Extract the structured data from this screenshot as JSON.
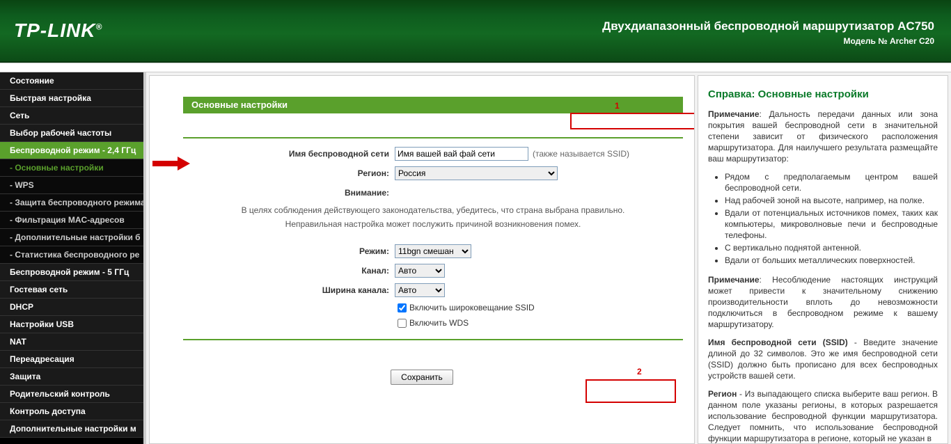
{
  "header": {
    "brand": "TP-LINK",
    "title": "Двухдиапазонный беспроводной маршрутизатор AC750",
    "model": "Модель № Archer C20"
  },
  "sidebar": {
    "items": [
      {
        "label": "Состояние",
        "type": "item"
      },
      {
        "label": "Быстрая настройка",
        "type": "item"
      },
      {
        "label": "Сеть",
        "type": "item"
      },
      {
        "label": "Выбор рабочей частоты",
        "type": "item"
      },
      {
        "label": "Беспроводной режим - 2,4 ГГц",
        "type": "active"
      },
      {
        "label": "- Основные настройки",
        "type": "sub-selected"
      },
      {
        "label": "- WPS",
        "type": "sub"
      },
      {
        "label": "- Защита беспроводного режима",
        "type": "sub"
      },
      {
        "label": "- Фильтрация MAC-адресов",
        "type": "sub"
      },
      {
        "label": "- Дополнительные настройки б",
        "type": "sub"
      },
      {
        "label": "- Статистика беспроводного ре",
        "type": "sub"
      },
      {
        "label": "Беспроводной режим - 5 ГГц",
        "type": "item"
      },
      {
        "label": "Гостевая сеть",
        "type": "item"
      },
      {
        "label": "DHCP",
        "type": "item"
      },
      {
        "label": "Настройки USB",
        "type": "item"
      },
      {
        "label": "NAT",
        "type": "item"
      },
      {
        "label": "Переадресация",
        "type": "item"
      },
      {
        "label": "Защита",
        "type": "item"
      },
      {
        "label": "Родительский контроль",
        "type": "item"
      },
      {
        "label": "Контроль доступа",
        "type": "item"
      },
      {
        "label": "Дополнительные настройки м",
        "type": "item"
      }
    ]
  },
  "page": {
    "title": "Основные настройки",
    "step1": "1",
    "step2": "2",
    "labels": {
      "ssid": "Имя беспроводной сети",
      "region": "Регион:",
      "attention": "Внимание:",
      "mode": "Режим:",
      "channel": "Канал:",
      "width": "Ширина канала:"
    },
    "values": {
      "ssid": "Имя вашей вай фай сети",
      "region": "Россия",
      "mode": "11bgn смешан",
      "channel": "Авто",
      "width": "Авто"
    },
    "hints": {
      "ssid_note": "(также называется SSID)",
      "note1": "В целях соблюдения действующего законодательства, убедитесь, что страна выбрана правильно.",
      "note2": "Неправильная настройка может послужить причиной возникновения помех.",
      "cb1": "Включить широковещание SSID",
      "cb2": "Включить WDS"
    },
    "save": "Сохранить"
  },
  "help": {
    "title": "Справка: Основные настройки",
    "p1_bold": "Примечание",
    "p1": ": Дальность передачи данных или зона покрытия вашей беспроводной сети в значительной степени зависит от физического расположения маршрутизатора. Для наилучшего результата размещайте ваш маршрутизатор:",
    "bullets": [
      "Рядом с предполагаемым центром вашей беспроводной сети.",
      "Над рабочей зоной на высоте, например, на полке.",
      "Вдали от потенциальных источников помех, таких как компьютеры, микроволновые печи и беспроводные телефоны.",
      "С вертикально поднятой антенной.",
      "Вдали от больших металлических поверхностей."
    ],
    "p2_bold": "Примечание",
    "p2": ": Несоблюдение настоящих инструкций может привести к значительному снижению производительности вплоть до невозможности подключиться в беспроводном режиме к вашему маршрутизатору.",
    "p3_bold": "Имя беспроводной сети (SSID)",
    "p3": " - Введите значение длиной до 32 символов. Это же имя беспроводной сети (SSID) должно быть прописано для всех беспроводных устройств вашей сети.",
    "p4_bold": "Регион",
    "p4": " - Из выпадающего списка выберите ваш регион. В данном поле указаны регионы, в которых разрешается использование беспроводной функции маршрутизатора. Следует помнить, что использование беспроводной функции маршрутизатора в регионе, который не указан в"
  }
}
